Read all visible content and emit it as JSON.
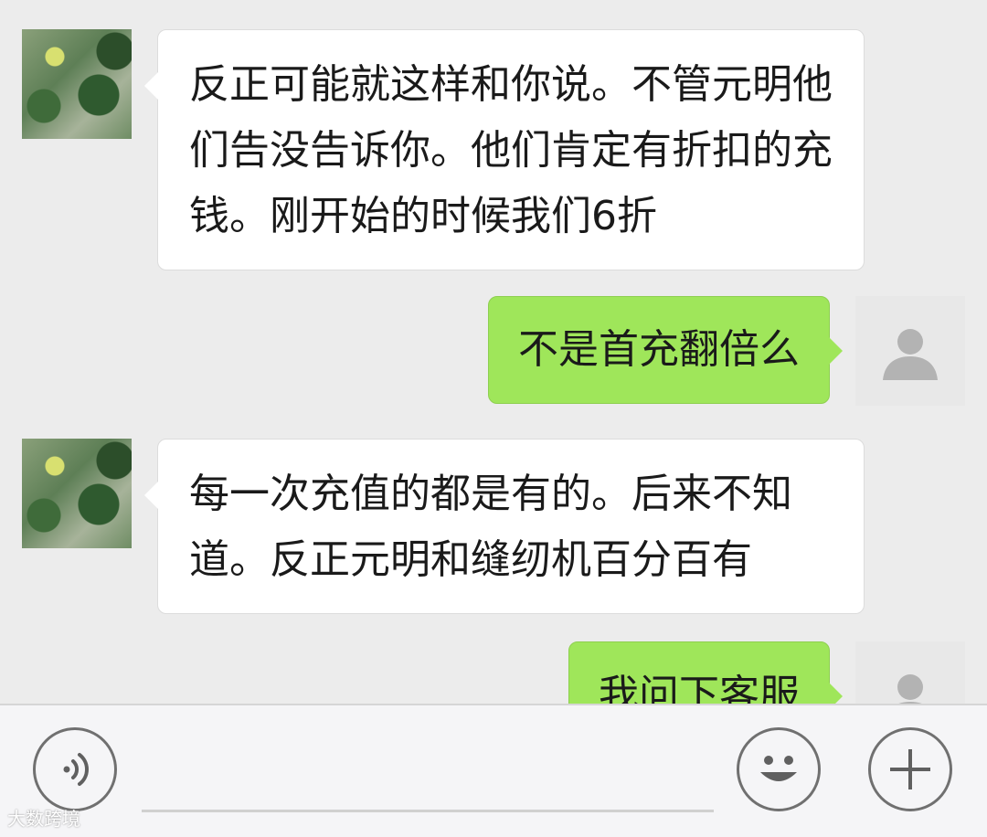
{
  "messages": [
    {
      "side": "in",
      "text": "反正可能就这样和你说。不管元明他们告没告诉你。他们肯定有折扣的充钱。刚开始的时候我们6折"
    },
    {
      "side": "out",
      "text": "不是首充翻倍么"
    },
    {
      "side": "in",
      "text": "每一次充值的都是有的。后来不知道。反正元明和缝纫机百分百有"
    },
    {
      "side": "out",
      "text": "我问下客服"
    }
  ],
  "input_bar": {
    "voice_icon": "voice-icon",
    "emoji_icon": "emoji-icon",
    "plus_icon": "plus-icon"
  },
  "watermark": "大数跨境",
  "colors": {
    "incoming_bubble": "#ffffff",
    "outgoing_bubble": "#9fe65a",
    "background": "#ececec"
  }
}
